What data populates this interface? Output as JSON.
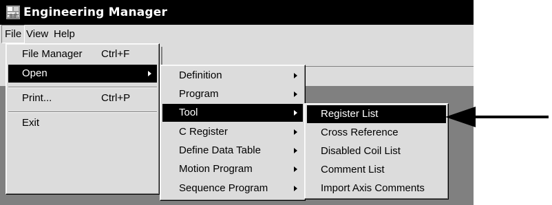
{
  "window": {
    "title": "Engineering Manager",
    "icon": "application-icon"
  },
  "menubar": {
    "items": [
      "File",
      "View",
      "Help"
    ],
    "active": "File"
  },
  "file_menu": {
    "items": [
      {
        "label": "File Manager",
        "shortcut": "Ctrl+F",
        "submenu": false
      },
      {
        "label": "Open",
        "shortcut": "",
        "submenu": true,
        "selected": true
      },
      {
        "label": "Print...",
        "shortcut": "Ctrl+P",
        "submenu": false
      },
      {
        "label": "Exit",
        "shortcut": "",
        "submenu": false
      }
    ]
  },
  "open_submenu": {
    "items": [
      {
        "label": "Definition",
        "submenu": true
      },
      {
        "label": "Program",
        "submenu": true
      },
      {
        "label": "Tool",
        "submenu": true,
        "selected": true
      },
      {
        "label": "C Register",
        "submenu": true
      },
      {
        "label": "Define Data Table",
        "submenu": true
      },
      {
        "label": "Motion Program",
        "submenu": true
      },
      {
        "label": "Sequence Program",
        "submenu": true
      }
    ]
  },
  "tool_submenu": {
    "items": [
      {
        "label": "Register List",
        "selected": true
      },
      {
        "label": "Cross Reference"
      },
      {
        "label": "Disabled Coil List"
      },
      {
        "label": "Comment List"
      },
      {
        "label": "Import Axis Comments"
      }
    ]
  },
  "annotation": {
    "icon": "left-pointing-arrow-icon"
  },
  "colors": {
    "selection": "#000000",
    "menu_bg": "#dcdcdc",
    "workspace": "#808080",
    "titlebar": "#000000"
  }
}
